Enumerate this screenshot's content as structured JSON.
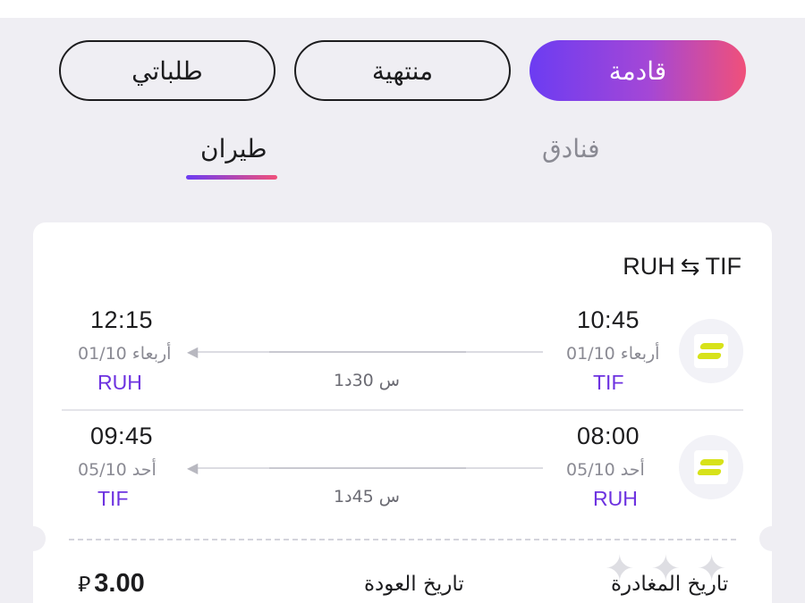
{
  "filters": {
    "arrivals": "قادمة",
    "finished": "منتهية",
    "my_requests": "طلباتي"
  },
  "tabs": {
    "hotels": "فنادق",
    "flight": "طيران"
  },
  "booking": {
    "route": {
      "from": "RUH",
      "to": "TIF",
      "swap_icon": "⇆"
    },
    "legs": [
      {
        "airline_icon": "flyadeal-logo-icon",
        "departure": {
          "time": "10:45",
          "date": "أربعاء 01/10",
          "code": "TIF"
        },
        "arrival": {
          "time": "12:15",
          "date": "أربعاء 01/10",
          "code": "RUH"
        },
        "duration": "1س 30د"
      },
      {
        "airline_icon": "flyadeal-logo-icon",
        "departure": {
          "time": "08:00",
          "date": "أحد 05/10",
          "code": "RUH"
        },
        "arrival": {
          "time": "09:45",
          "date": "أحد 05/10",
          "code": "TIF"
        },
        "duration": "1س 45د"
      }
    ],
    "footer": {
      "departure_date_label": "تاريخ المغادرة",
      "return_date_label": "تاريخ العودة",
      "price": "3.00",
      "currency_symbol": "⃁"
    }
  },
  "colors": {
    "accent_purple": "#6d32e0",
    "gradient_start": "#6c3cf2",
    "gradient_end": "#f0507a",
    "logo_yellow": "#d7e21a"
  }
}
